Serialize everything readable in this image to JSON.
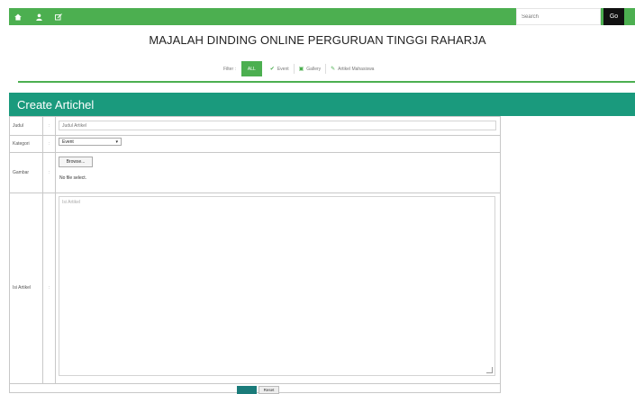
{
  "topbar": {
    "icons": [
      "home-icon",
      "user-icon",
      "edit-icon"
    ],
    "search_placeholder": "Search",
    "go_label": "Go"
  },
  "page_title": "MAJALAH DINDING ONLINE PERGURUAN TINGGI RAHARJA",
  "filter": {
    "label": "Filter :",
    "active": "ALL",
    "items": [
      {
        "icon": "check-icon",
        "label": "Event"
      },
      {
        "icon": "image-icon",
        "label": "Gallery"
      },
      {
        "icon": "pin-icon",
        "label": "Artikel Mahasiswa"
      }
    ]
  },
  "panel": {
    "title": "Create Artichel"
  },
  "form": {
    "judul": {
      "label": "Judul",
      "sep": ":",
      "placeholder": "Judul Artikel"
    },
    "kategori": {
      "label": "Kategori",
      "sep": ":",
      "value": "Event"
    },
    "gambar": {
      "label": "Gambar",
      "sep": ":",
      "browse_label": "Browse...",
      "file_status": "No file select."
    },
    "isi": {
      "label": "Isi Artikel",
      "sep": ":",
      "placeholder": "Isi Artikel"
    },
    "reset_label": "Reset"
  },
  "colors": {
    "green": "#4caf50",
    "teal": "#1a9a7d",
    "button_teal": "#1a7b7a"
  }
}
